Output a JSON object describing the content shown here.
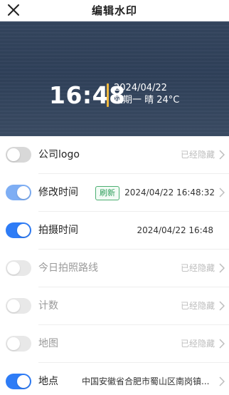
{
  "header": {
    "title": "编辑水印",
    "close_icon": "close-icon"
  },
  "watermark": {
    "time": "16:48",
    "date": "2024/04/22",
    "weekday_weather": "星期一 晴 24°C",
    "accent_color": "#f0b83c"
  },
  "settings": {
    "items": [
      {
        "label": "公司logo",
        "enabled": false,
        "value": "已经隐藏"
      },
      {
        "label": "修改时间",
        "enabled": true,
        "badge": "刷新",
        "value": "2024/04/22 16:48:32"
      },
      {
        "label": "拍摄时间",
        "enabled": true,
        "value": "2024/04/22 16:48"
      },
      {
        "label": "今日拍照路线",
        "enabled": false,
        "value": "已经隐藏"
      },
      {
        "label": "计数",
        "enabled": false,
        "value": "已经隐藏"
      },
      {
        "label": "地图",
        "enabled": false,
        "value": "已经隐藏"
      },
      {
        "label": "地点",
        "enabled": true,
        "value": "中国安徽省合肥市蜀山区南岗镇..."
      }
    ]
  },
  "colors": {
    "toggle_on": "#2e7cf6",
    "toggle_on_light": "#7eaef4",
    "toggle_off": "#d8d8d8",
    "badge_green": "#2e9e5b"
  }
}
